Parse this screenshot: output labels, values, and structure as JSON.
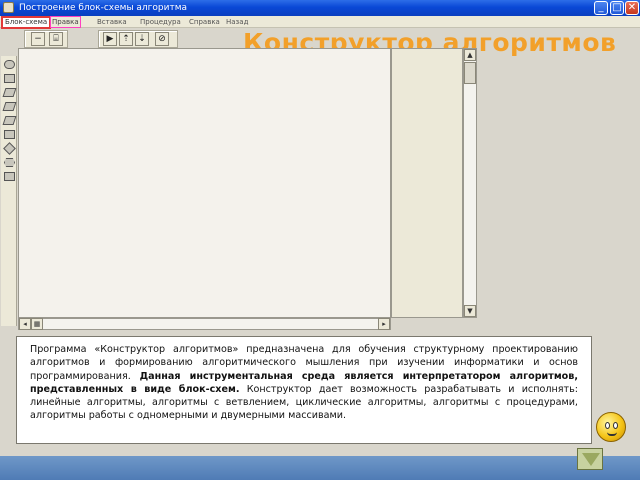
{
  "window": {
    "title": "Построение блок-схемы алгоритма"
  },
  "menu": [
    "Блок-схема",
    "Правка",
    "Вставка",
    "Процедура",
    "Справка",
    "Назад"
  ],
  "heading": "Конструктор алгоритмов",
  "description": {
    "part1": "Программа «Конструктор алгоритмов» предназначена для обучения структурному проектированию алгоритмов и формированию алгоритмического мышления при изучении информатики и основ программирования. ",
    "bold": "Данная инструментальная среда является интерпретатором алгоритмов, представленных в виде блок-схем.",
    "part2": " Конструктор дает возможность разрабатывать и исполнять: линейные алгоритмы, алгоритмы с ветвлением, циклические алгоритмы, алгоритмы с процедурами, алгоритмы работы с одномерными и двумерными массивами."
  },
  "icons": {
    "minimize": "minimize-icon",
    "maximize": "maximize-icon",
    "close": "close-icon",
    "next": "down-triangle-icon"
  },
  "colors": {
    "heading": "#f2a02a",
    "titlebar": "#0a48d6",
    "bottom_bar": "#4f7bb5"
  }
}
